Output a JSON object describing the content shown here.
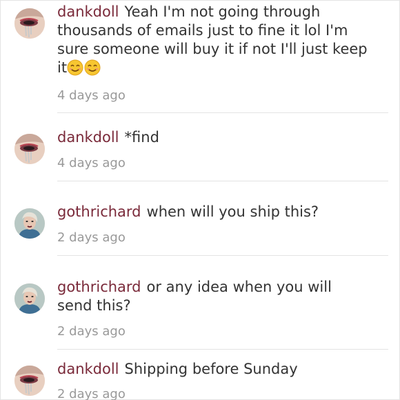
{
  "comments": [
    {
      "avatar": "dankdoll-avatar",
      "username": "dankdoll",
      "text": "Yeah I'm not going through thousands of emails just to fine it lol I'm sure someone will buy it if not I'll just keep it",
      "emoji": [
        "smiling-face-emoji",
        "smiling-face-emoji"
      ],
      "time": "4 days ago"
    },
    {
      "avatar": "dankdoll-avatar",
      "username": "dankdoll",
      "text": "*find",
      "time": "4 days ago"
    },
    {
      "avatar": "gothrichard-avatar",
      "username": "gothrichard",
      "text": "when will you ship this?",
      "time": "2 days ago"
    },
    {
      "avatar": "gothrichard-avatar",
      "username": "gothrichard",
      "text": "or any idea when you will send this?",
      "time": "2 days ago"
    },
    {
      "avatar": "dankdoll-avatar",
      "username": "dankdoll",
      "text": "Shipping before Sunday",
      "time": "2 days ago"
    }
  ],
  "colors": {
    "username": "#7a2a3a",
    "text": "#333333",
    "time": "#999999",
    "divider": "#e3e3e3"
  }
}
